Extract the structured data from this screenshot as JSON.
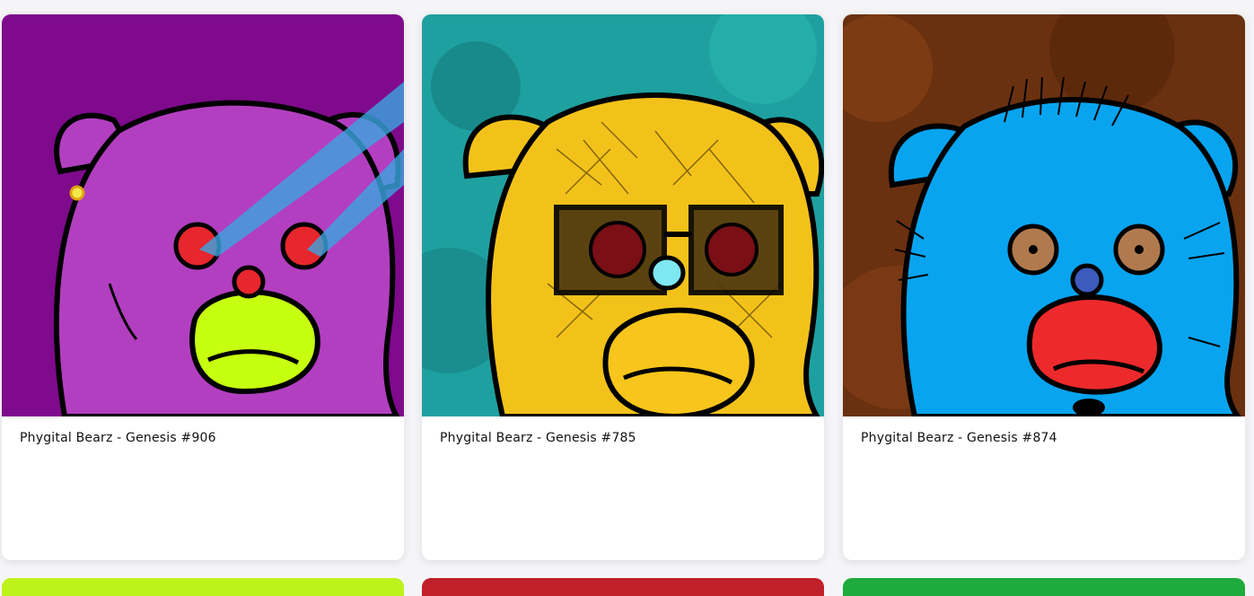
{
  "cards": [
    {
      "title": "Phygital Bearz - Genesis #906",
      "background": "#7f0a8c",
      "fur": "#b23fc0",
      "muzzle": "#c6ff10",
      "nose": "#e8262e",
      "eye": "#e8262e",
      "accent": "#3aa6e0"
    },
    {
      "title": "Phygital Bearz - Genesis #785",
      "background": "#1fa0a0",
      "fur": "#f3c21a",
      "muzzle": "#f7c51b",
      "nose": "#7fe7f2",
      "eye": "#7a0f16",
      "accent": "#5a3b12"
    },
    {
      "title": "Phygital Bearz - Genesis #874",
      "background": "#6a3110",
      "fur": "#09a4f0",
      "muzzle": "#ec2a2c",
      "nose": "#3c5bbd",
      "eye": "#b07a4e",
      "accent": "#000000"
    }
  ],
  "next_row_colors": [
    "#bdf21a",
    "#c0202a",
    "#1eaa3c"
  ]
}
